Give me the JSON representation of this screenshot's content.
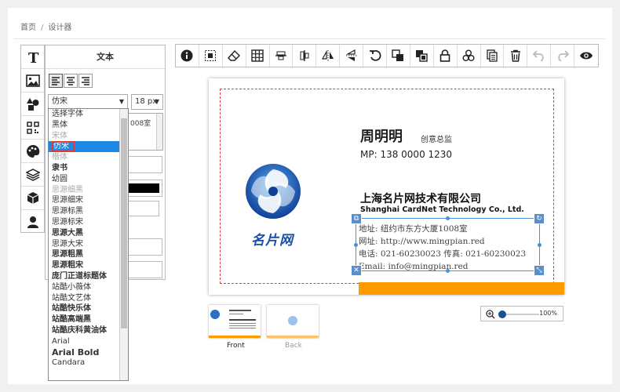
{
  "breadcrumb": {
    "home": "首页",
    "sep": "/",
    "current": "设计器"
  },
  "text_panel": {
    "title": "文本",
    "font_select": "仿宋",
    "size_select": "18 px",
    "textarea_text": "008室",
    "font_options": [
      "选择字体",
      "黑体",
      "宋体",
      "仿宋",
      "楷体",
      "隶书",
      "幼圆",
      "思源细黑",
      "思源细宋",
      "思源标黑",
      "思源标宋",
      "思源大黑",
      "思源大宋",
      "思源粗黑",
      "思源粗宋",
      "庞门正道标题体",
      "站酷小薇体",
      "站酷文艺体",
      "站酷快乐体",
      "站酷高端黑",
      "站酷庆科黄油体",
      "Arial",
      "Arial Bold",
      "Candara"
    ],
    "selected_font": "仿宋"
  },
  "toolbar_icons": [
    "info-icon",
    "select-frame-icon",
    "eraser-icon",
    "grid-icon",
    "align-vertical-center-icon",
    "align-horizontal-center-icon",
    "flip-horizontal-icon",
    "flip-vertical-icon",
    "rotate-icon",
    "bring-forward-icon",
    "send-backward-icon",
    "lock-icon",
    "group-icon",
    "copy-icon",
    "delete-icon",
    "undo-icon",
    "redo-icon",
    "preview-icon"
  ],
  "card": {
    "name": "周明明",
    "role": "创意总监",
    "phone": "MP: 138 0000 1230",
    "company_cn": "上海名片网技术有限公司",
    "company_en": "Shanghai CardNet Technology Co., Ltd.",
    "address_lines": [
      "地址: 纽约市东方大厦1008室",
      "网址: http://www.mingpian.red",
      "电话: 021-60230023  传真: 021-60230023",
      "Email: info@mingpian.red"
    ],
    "brand": "名片网",
    "colors": {
      "accent": "#ff9a00",
      "brand_blue": "#1a4fa5",
      "guide": "#e23a3a"
    }
  },
  "thumbnails": {
    "front": "Front",
    "back": "Back"
  },
  "zoom": {
    "value": "100%",
    "level": 0.1
  }
}
